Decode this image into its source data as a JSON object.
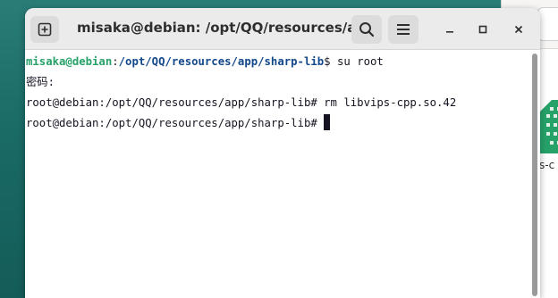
{
  "window": {
    "title": "misaka@debian: /opt/QQ/resources/ap…"
  },
  "icons": {
    "new_tab": "new-tab-icon",
    "search": "search-icon",
    "menu": "hamburger-menu-icon",
    "minimize": "minimize-icon",
    "maximize": "maximize-icon",
    "close": "close-icon"
  },
  "terminal": {
    "line1": {
      "user_host": "misaka@debian",
      "separator": ":",
      "cwd": "/opt/QQ/resources/app/sharp-lib",
      "prompt_end": "$ ",
      "command": "su root"
    },
    "line2": {
      "text": "密码:"
    },
    "line3": {
      "prompt": "root@debian:/opt/QQ/resources/app/sharp-lib# ",
      "command": "rm libvips-cpp.so.42"
    },
    "line4": {
      "prompt": "root@debian:/opt/QQ/resources/app/sharp-lib# "
    }
  },
  "background_window": {
    "file_label": "s-c"
  },
  "colors": {
    "user_host": "#26a269",
    "cwd": "#12488b",
    "text": "#171421",
    "desktop": "#1a6a66",
    "file_icon": "#26a269"
  }
}
